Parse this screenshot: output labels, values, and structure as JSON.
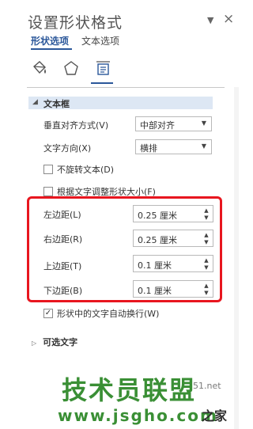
{
  "pane": {
    "title": "设置形状格式",
    "pin_icon": "▼",
    "close_icon": "×"
  },
  "tabs": {
    "shape_options": "形状选项",
    "text_options": "文本选项"
  },
  "icons": [
    "fill-line-icon",
    "effects-icon",
    "layout-properties-icon"
  ],
  "section": {
    "toggle": "◢",
    "title": "文本框",
    "vertical_align_label": "垂直对齐方式(V)",
    "vertical_align_value": "中部对齐",
    "text_direction_label": "文字方向(X)",
    "text_direction_value": "横排",
    "no_rotate_label": "不旋转文本(D)",
    "autofit_label": "根据文字调整形状大小(F)",
    "left_margin_label": "左边距(L)",
    "left_margin_value": "0.25 厘米",
    "right_margin_label": "右边距(R)",
    "right_margin_value": "0.25 厘米",
    "top_margin_label": "上边距(T)",
    "top_margin_value": "0.1 厘米",
    "bottom_margin_label": "下边距(B)",
    "bottom_margin_value": "0.1 厘米",
    "wrap_label": "形状中的文字自动换行(W)",
    "wrap_checked_mark": "✓"
  },
  "optional_section": {
    "toggle": "▷",
    "title": "可选文字"
  },
  "watermark": {
    "brand": "技术员联盟",
    "url": "www.jsgho.com",
    "partial_51": "51.net",
    "partial_home": "之家"
  },
  "colors": {
    "accent": "#2b579a",
    "highlight_box": "#e8161f",
    "section_bg": "#dde7f4",
    "watermark_green": "#3a8f35"
  }
}
